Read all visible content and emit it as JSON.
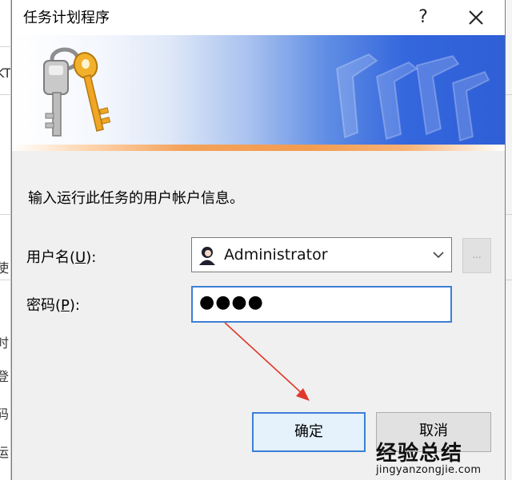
{
  "window": {
    "title": "任务计划程序",
    "help_label": "?"
  },
  "background_window": {
    "fragments": [
      "KT",
      "使",
      "时",
      "登",
      "码",
      "运"
    ]
  },
  "dialog": {
    "prompt": "输入运行此任务的用户帐户信息。",
    "user_label": "用户名(",
    "user_accel": "U",
    "user_label_end": "):",
    "password_label": "密码(",
    "password_accel": "P",
    "password_label_end": "):",
    "user_value": "Administrator",
    "password_mask": "●●●●",
    "browse_label": "...",
    "ok_label": "确定",
    "cancel_label": "取消"
  },
  "watermark": {
    "title": "经验总结",
    "url": "jingyanzongjie.com"
  },
  "colors": {
    "focus_border": "#3c7fd6",
    "arrow": "#e0392b",
    "banner_blue": "#2f5fd6",
    "banner_orange": "#f39c50"
  },
  "icons": {
    "keys": "keys-icon",
    "user": "user-avatar-icon",
    "dropdown": "chevron-down-icon",
    "close": "close-icon"
  }
}
